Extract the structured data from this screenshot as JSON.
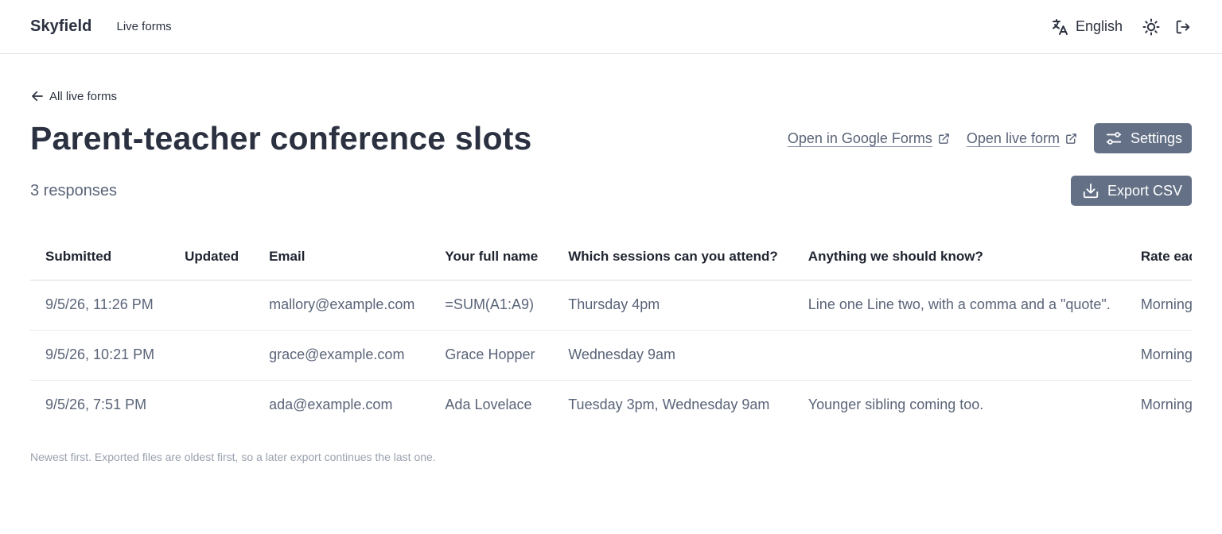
{
  "header": {
    "brand": "Skyfield",
    "nav_live_forms": "Live forms",
    "language": "English"
  },
  "icons": {
    "translate": "translate-icon",
    "theme": "sun-icon",
    "logout": "logout-icon",
    "back": "arrow-left-icon",
    "external": "external-link-icon",
    "settings": "sliders-icon",
    "download": "download-icon"
  },
  "colors": {
    "button_bg": "#637086",
    "text_dark": "#2b3140",
    "text_muted": "#5a6478"
  },
  "page": {
    "back_label": "All live forms",
    "title": "Parent-teacher conference slots",
    "open_google_forms": "Open in Google Forms",
    "open_live_form": "Open live form",
    "settings_label": "Settings",
    "responses_count": "3 responses",
    "export_label": "Export CSV",
    "footnote": "Newest first. Exported files are oldest first, so a later export continues the last one."
  },
  "table": {
    "headers": [
      "Submitted",
      "Updated",
      "Email",
      "Your full name",
      "Which sessions can you attend?",
      "Anything we should know?",
      "Rate each option"
    ],
    "rows": [
      [
        "9/5/26, 11:26 PM",
        "",
        "mallory@example.com",
        "=SUM(A1:A9)",
        "Thursday 4pm",
        "Line one Line two, with a comma and a \"quote\".",
        "Morning: Tight"
      ],
      [
        "9/5/26, 10:21 PM",
        "",
        "grace@example.com",
        "Grace Hopper",
        "Wednesday 9am",
        "",
        "Morning: No; A"
      ],
      [
        "9/5/26, 7:51 PM",
        "",
        "ada@example.com",
        "Ada Lovelace",
        "Tuesday 3pm, Wednesday 9am",
        "Younger sibling coming too.",
        "Morning: Work"
      ]
    ]
  }
}
